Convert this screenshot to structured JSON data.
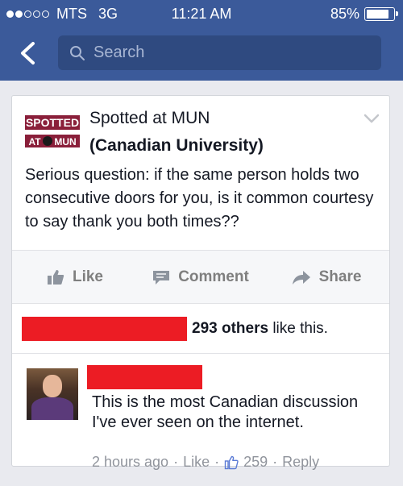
{
  "status_bar": {
    "carrier": "MTS",
    "network": "3G",
    "time": "11:21 AM",
    "battery": "85%",
    "signal_bars": 2,
    "battery_level": 0.85
  },
  "nav": {
    "search_placeholder": "Search"
  },
  "post": {
    "page_name": "Spotted at MUN",
    "annotation": "(Canadian University)",
    "logo_text": [
      "SPOTTED",
      "AT",
      "MUN"
    ],
    "text": "Serious question: if the same person holds two consecutive doors for you, is it common courtesy to say thank you both times??",
    "actions": {
      "like": "Like",
      "comment": "Comment",
      "share": "Share"
    },
    "likes": {
      "count_text": "293 others",
      "suffix": " like this."
    }
  },
  "comment": {
    "text": "This is the most Canadian discussion I've ever seen on the internet.",
    "time": "2 hours ago",
    "like_label": "Like",
    "like_count": "259",
    "reply_label": "Reply",
    "sep": "·"
  },
  "colors": {
    "facebook_blue": "#3b5a9a",
    "search_bg": "#2f4a80",
    "redaction": "#ec1c24",
    "logo_maroon": "#8a1f3a"
  }
}
